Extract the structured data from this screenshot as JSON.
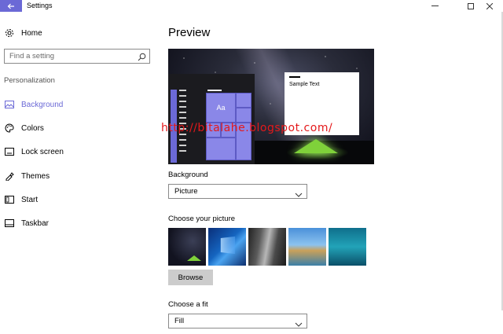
{
  "window": {
    "title": "Settings",
    "controls": [
      "minimize",
      "maximize",
      "close"
    ]
  },
  "sidebar": {
    "home_label": "Home",
    "search_placeholder": "Find a setting",
    "section_label": "Personalization",
    "items": [
      {
        "label": "Background",
        "icon": "picture-icon",
        "active": true
      },
      {
        "label": "Colors",
        "icon": "palette-icon",
        "active": false
      },
      {
        "label": "Lock screen",
        "icon": "lock-screen-icon",
        "active": false
      },
      {
        "label": "Themes",
        "icon": "themes-icon",
        "active": false
      },
      {
        "label": "Start",
        "icon": "start-icon",
        "active": false
      },
      {
        "label": "Taskbar",
        "icon": "taskbar-icon",
        "active": false
      }
    ]
  },
  "main": {
    "title": "Preview",
    "preview": {
      "tile_text": "Aa",
      "sample_text": "Sample Text"
    },
    "background_label": "Background",
    "background_value": "Picture",
    "choose_picture_label": "Choose your picture",
    "pictures": [
      "night-sky-tent",
      "windows-hero",
      "rock-wall",
      "beach-rocks",
      "underwater-swimmer"
    ],
    "browse_label": "Browse",
    "fit_label": "Choose a fit",
    "fit_value": "Fill"
  },
  "watermark": "http://bitalahe.blogspot.com/",
  "colors": {
    "accent": "#6b69d6",
    "watermark": "#e4191b",
    "tent": "#7fd13a"
  }
}
